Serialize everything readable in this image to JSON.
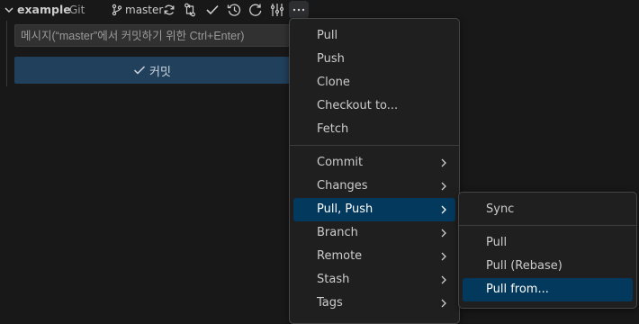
{
  "header": {
    "repo_name": "example",
    "repo_type": "Git",
    "branch": "master"
  },
  "commit": {
    "placeholder": "메시지(“master”에서 커밋하기 위한 Ctrl+Enter)",
    "button_label": "커밋"
  },
  "menu": {
    "items": [
      {
        "label": "Pull"
      },
      {
        "label": "Push"
      },
      {
        "label": "Clone"
      },
      {
        "label": "Checkout to..."
      },
      {
        "label": "Fetch"
      },
      {
        "label": "Commit",
        "submenu": true
      },
      {
        "label": "Changes",
        "submenu": true
      },
      {
        "label": "Pull, Push",
        "submenu": true
      },
      {
        "label": "Branch",
        "submenu": true
      },
      {
        "label": "Remote",
        "submenu": true
      },
      {
        "label": "Stash",
        "submenu": true
      },
      {
        "label": "Tags",
        "submenu": true
      }
    ],
    "active": "Pull, Push"
  },
  "submenu": {
    "items": [
      {
        "label": "Sync"
      },
      {
        "label": "Pull"
      },
      {
        "label": "Pull (Rebase)"
      },
      {
        "label": "Pull from..."
      }
    ],
    "active": "Pull from..."
  },
  "colors": {
    "background": "#181818",
    "menu_bg": "#1f1f1f",
    "highlight": "#04395e",
    "commit_button": "#21405c"
  }
}
